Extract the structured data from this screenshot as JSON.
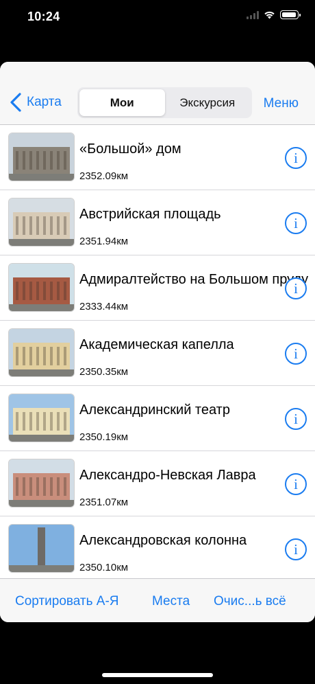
{
  "status_bar": {
    "time": "10:24"
  },
  "navbar": {
    "back_label": "Карта",
    "segments": [
      {
        "label": "Мои",
        "selected": true
      },
      {
        "label": "Экскурсия",
        "selected": false
      }
    ],
    "menu_label": "Меню"
  },
  "list": [
    {
      "title": "«Большой» дом",
      "distance": "2352.09км",
      "thumb_icon": "building-photo",
      "sky": "#c9d3dc",
      "facade": "#8a8378"
    },
    {
      "title": "Австрийская площадь",
      "distance": "2351.94км",
      "thumb_icon": "building-photo",
      "sky": "#d6dde3",
      "facade": "#d8cbb6"
    },
    {
      "title": "Адмиралтейство на Большом пруду",
      "distance": "2333.44км",
      "thumb_icon": "building-photo",
      "sky": "#cfe0e8",
      "facade": "#a65a43"
    },
    {
      "title": "Академическая капелла",
      "distance": "2350.35км",
      "thumb_icon": "building-photo",
      "sky": "#c4d4e2",
      "facade": "#e2cf9e"
    },
    {
      "title": "Александринский театр",
      "distance": "2350.19км",
      "thumb_icon": "building-photo",
      "sky": "#9fc4e6",
      "facade": "#eadfb8"
    },
    {
      "title": "Александро-Невская Лавра",
      "distance": "2351.07км",
      "thumb_icon": "building-photo",
      "sky": "#d2dde6",
      "facade": "#c98e7c"
    },
    {
      "title": "Александровская колонна",
      "distance": "2350.10км",
      "thumb_icon": "column-photo",
      "sky": "#7fb0e0",
      "facade": "#6e6a66"
    }
  ],
  "toolbar": {
    "sort_label": "Сортировать А-Я",
    "places_label": "Места",
    "clear_label": "Очис...ь всё"
  },
  "colors": {
    "accent": "#1a7cf0",
    "background": "#000000",
    "sheet": "#ffffff"
  }
}
